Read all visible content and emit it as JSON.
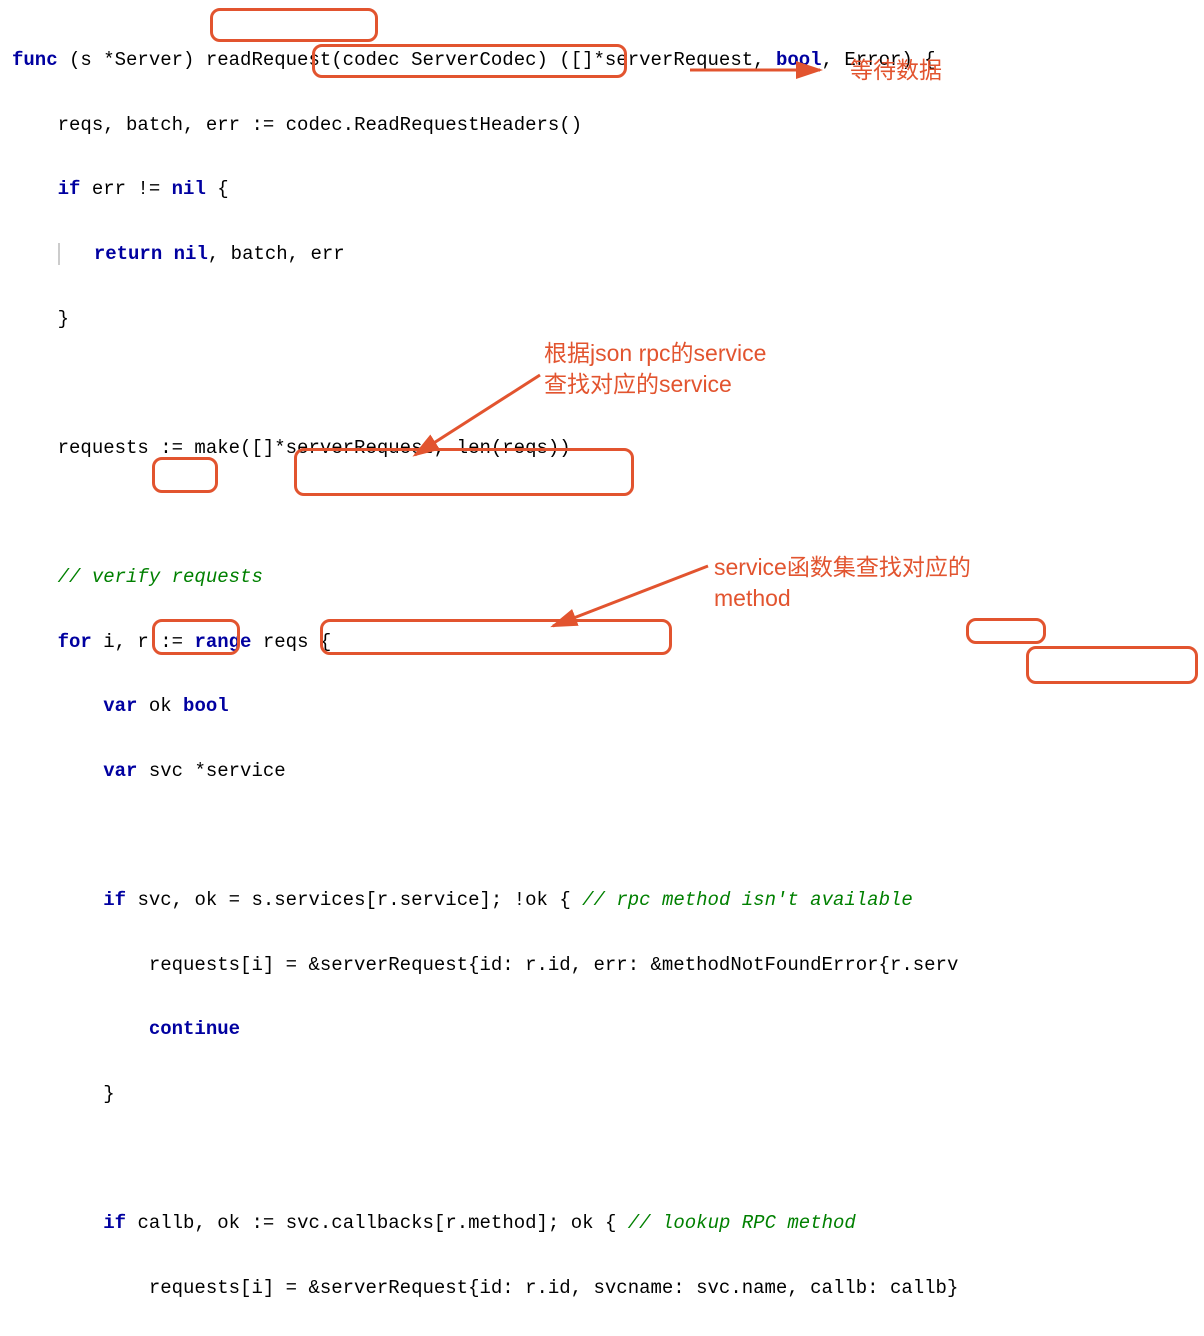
{
  "code": {
    "l1_func": "func",
    "l1_rec": " (s *Server) ",
    "l1_name": "readRequest",
    "l1_sig1": "(codec ServerCodec) ([]*serverRequest, ",
    "l1_bool": "bool",
    "l1_sig2": ", Error) {",
    "l2_a": "    reqs, batch, err := ",
    "l2_b": "codec.ReadRequestHeaders()",
    "l3_if": "if",
    "l3_rest": " err != ",
    "l3_nil": "nil",
    "l3_brace": " {",
    "l4_ret": "return nil",
    "l4_rest": ", batch, err",
    "l5": "    }",
    "l7": "    requests := make([]*serverRequest, len(reqs))",
    "l9_comment": "// verify requests",
    "l10_for": "for",
    "l10_a": " i, r := ",
    "l10_range": "range",
    "l10_b": " reqs {",
    "l11_var": "var",
    "l11_a": " ok ",
    "l11_bool": "bool",
    "l12_var": "var",
    "l12_a": " svc *service",
    "l14_if": "if",
    "l14_a": " ",
    "l14_svc": "svc,",
    "l14_b": " ok = ",
    "l14_expr": "s.services[r.service];",
    "l14_c": " !ok { ",
    "l14_comment": "// rpc method isn't available",
    "l15": "            requests[i] = &serverRequest{id: r.id, err: &methodNotFoundError{r.serv",
    "l16_cont": "continue",
    "l17": "        }",
    "l19_if": "if",
    "l19_a": " ",
    "l19_callb": "callb,",
    "l19_b": " ok := ",
    "l19_expr": "svc.callbacks[r.method];",
    "l19_c": " ok { ",
    "l19_comment": "// lookup RPC method",
    "l20_a": "            requests[i] = &serverRequest{id: r.id, svcname: svc.name,",
    "l20_b": " callb: callb}"
  },
  "annotations": {
    "a1": "等待数据",
    "a2_line1": "根据json rpc的service",
    "a2_line2": "查找对应的service",
    "a3_line1": "service函数集查找对应的",
    "a3_line2": "method"
  }
}
